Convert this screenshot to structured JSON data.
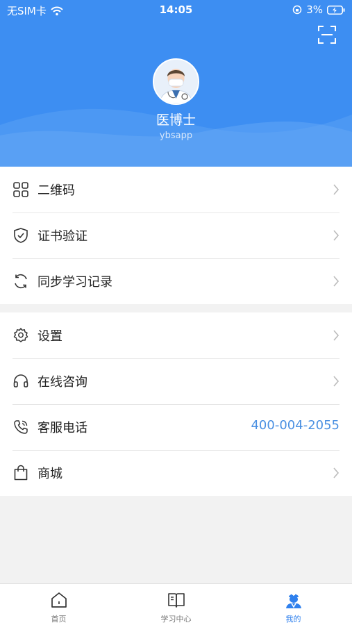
{
  "status_bar": {
    "carrier": "无SIM卡",
    "time": "14:05",
    "battery": "3%"
  },
  "profile": {
    "name": "医博士",
    "username": "ybsapp"
  },
  "menu_group_1": [
    {
      "label": "二维码",
      "icon": "qrcode-icon"
    },
    {
      "label": "证书验证",
      "icon": "shield-check-icon"
    },
    {
      "label": "同步学习记录",
      "icon": "sync-icon"
    }
  ],
  "menu_group_2": [
    {
      "label": "设置",
      "icon": "gear-icon"
    },
    {
      "label": "在线咨询",
      "icon": "headset-icon"
    },
    {
      "label": "客服电话",
      "icon": "phone-icon",
      "value": "400-004-2055"
    },
    {
      "label": "商城",
      "icon": "shopping-bag-icon"
    }
  ],
  "tabbar": {
    "tabs": [
      {
        "label": "首页",
        "icon": "home-icon",
        "active": false
      },
      {
        "label": "学习中心",
        "icon": "book-icon",
        "active": false
      },
      {
        "label": "我的",
        "icon": "doctor-icon",
        "active": true
      }
    ]
  },
  "colors": {
    "header": "#3d8ef2",
    "accent": "#2f80ed",
    "phone": "#4a90e2"
  }
}
